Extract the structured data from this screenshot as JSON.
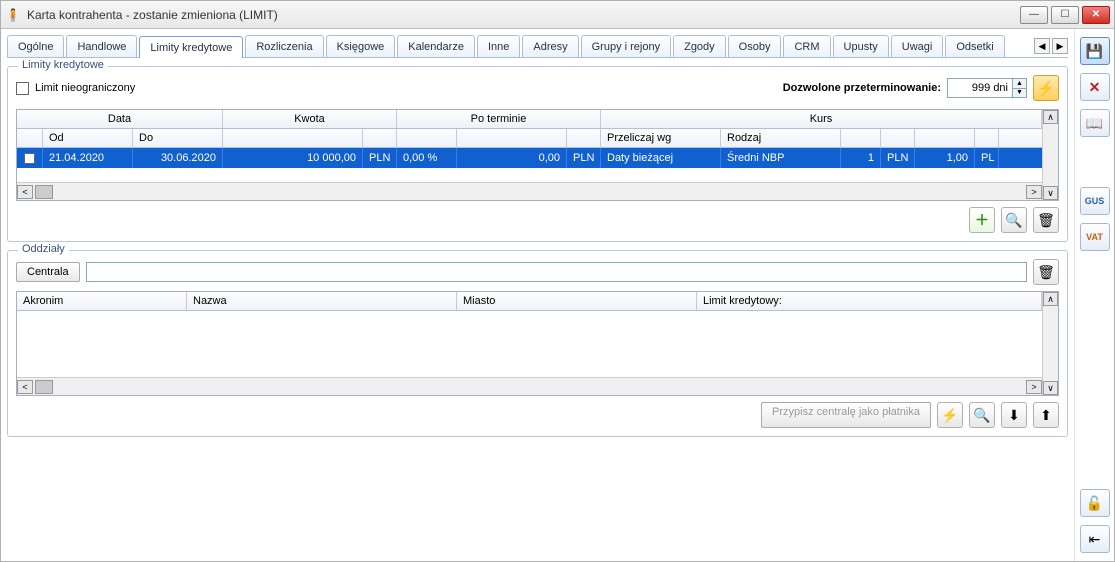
{
  "window": {
    "title": "Karta kontrahenta - zostanie zmieniona (LIMIT)"
  },
  "tabs": [
    "Ogólne",
    "Handlowe",
    "Limity kredytowe",
    "Rozliczenia",
    "Księgowe",
    "Kalendarze",
    "Inne",
    "Adresy",
    "Grupy i rejony",
    "Zgody",
    "Osoby",
    "CRM",
    "Upusty",
    "Uwagi",
    "Odsetki"
  ],
  "activeTab": "Limity kredytowe",
  "limits": {
    "group_label": "Limity kredytowe",
    "unlimited_label": "Limit nieograniczony",
    "allowed_overdue_label": "Dozwolone przeterminowanie:",
    "allowed_overdue_value": "999 dni",
    "headers": {
      "data_group": "Data",
      "od": "Od",
      "do": "Do",
      "kwota": "Kwota",
      "po_terminie": "Po terminie",
      "kurs_group": "Kurs",
      "przeliczaj": "Przeliczaj wg",
      "rodzaj": "Rodzaj"
    },
    "rows": [
      {
        "checked": false,
        "od": "21.04.2020",
        "do": "30.06.2020",
        "kwota": "10 000,00",
        "cur1": "PLN",
        "proc": "0,00 %",
        "poterm": "0,00",
        "cur2": "PLN",
        "przeliczaj": "Daty bieżącej",
        "rodzaj": "Średni NBP",
        "n": "1",
        "cur3": "PLN",
        "rate": "1,00",
        "cur4": "PL"
      }
    ]
  },
  "branches": {
    "group_label": "Oddziały",
    "centrala_btn": "Centrala",
    "headers": {
      "akronim": "Akronim",
      "nazwa": "Nazwa",
      "miasto": "Miasto",
      "limit": "Limit kredytowy:"
    },
    "assign_btn": "Przypisz centralę jako płatnika"
  },
  "icons": {
    "min": "—",
    "max": "☐",
    "close": "✕",
    "bolt": "⚡",
    "add": "＋",
    "search": "🔍",
    "trash": "🗑",
    "save": "💾",
    "book": "📖",
    "gus": "GUS",
    "vat": "VAT",
    "lock": "🔓",
    "door": "⇤",
    "doc_in": "⬇",
    "doc_out": "⬆",
    "left": "◀",
    "right": "▶",
    "up": "▲",
    "down": "▼"
  }
}
